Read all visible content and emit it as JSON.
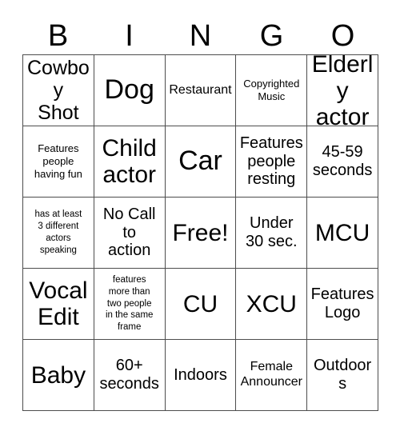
{
  "card": {
    "title": "BINGO",
    "header_letters": [
      "B",
      "I",
      "N",
      "G",
      "O"
    ],
    "free_space_label": "Free!",
    "colors": {
      "background": "#ffffff",
      "grid_line": "#4d4d4d",
      "text": "#000000"
    },
    "grid": {
      "columns": 5,
      "rows": 5,
      "cells": [
        {
          "text": "Cowboy\nShot",
          "size": "lg"
        },
        {
          "text": "Dog",
          "size": "xxl"
        },
        {
          "text": "Restaurant",
          "size": "sm"
        },
        {
          "text": "Copyrighted\nMusic",
          "size": "xs"
        },
        {
          "text": "Elderly\nactor",
          "size": "xl"
        },
        {
          "text": "Features\npeople\nhaving fun",
          "size": "xs"
        },
        {
          "text": "Child\nactor",
          "size": "xl"
        },
        {
          "text": "Car",
          "size": "xxl"
        },
        {
          "text": "Features\npeople\nresting",
          "size": "md"
        },
        {
          "text": "45-59\nseconds",
          "size": "md"
        },
        {
          "text": "has at least\n3 different\nactors\nspeaking",
          "size": "xxs"
        },
        {
          "text": "No Call\nto\naction",
          "size": "md"
        },
        {
          "text": "Free!",
          "size": "xl"
        },
        {
          "text": "Under\n30 sec.",
          "size": "md"
        },
        {
          "text": "MCU",
          "size": "xl"
        },
        {
          "text": "Vocal\nEdit",
          "size": "xl"
        },
        {
          "text": "features\nmore than\ntwo people\nin the same\nframe",
          "size": "xxs"
        },
        {
          "text": "CU",
          "size": "xl"
        },
        {
          "text": "XCU",
          "size": "xl"
        },
        {
          "text": "Features\nLogo",
          "size": "md"
        },
        {
          "text": "Baby",
          "size": "xl"
        },
        {
          "text": "60+\nseconds",
          "size": "md"
        },
        {
          "text": "Indoors",
          "size": "md"
        },
        {
          "text": "Female\nAnnouncer",
          "size": "sm"
        },
        {
          "text": "Outdoors",
          "size": "md"
        }
      ]
    }
  }
}
